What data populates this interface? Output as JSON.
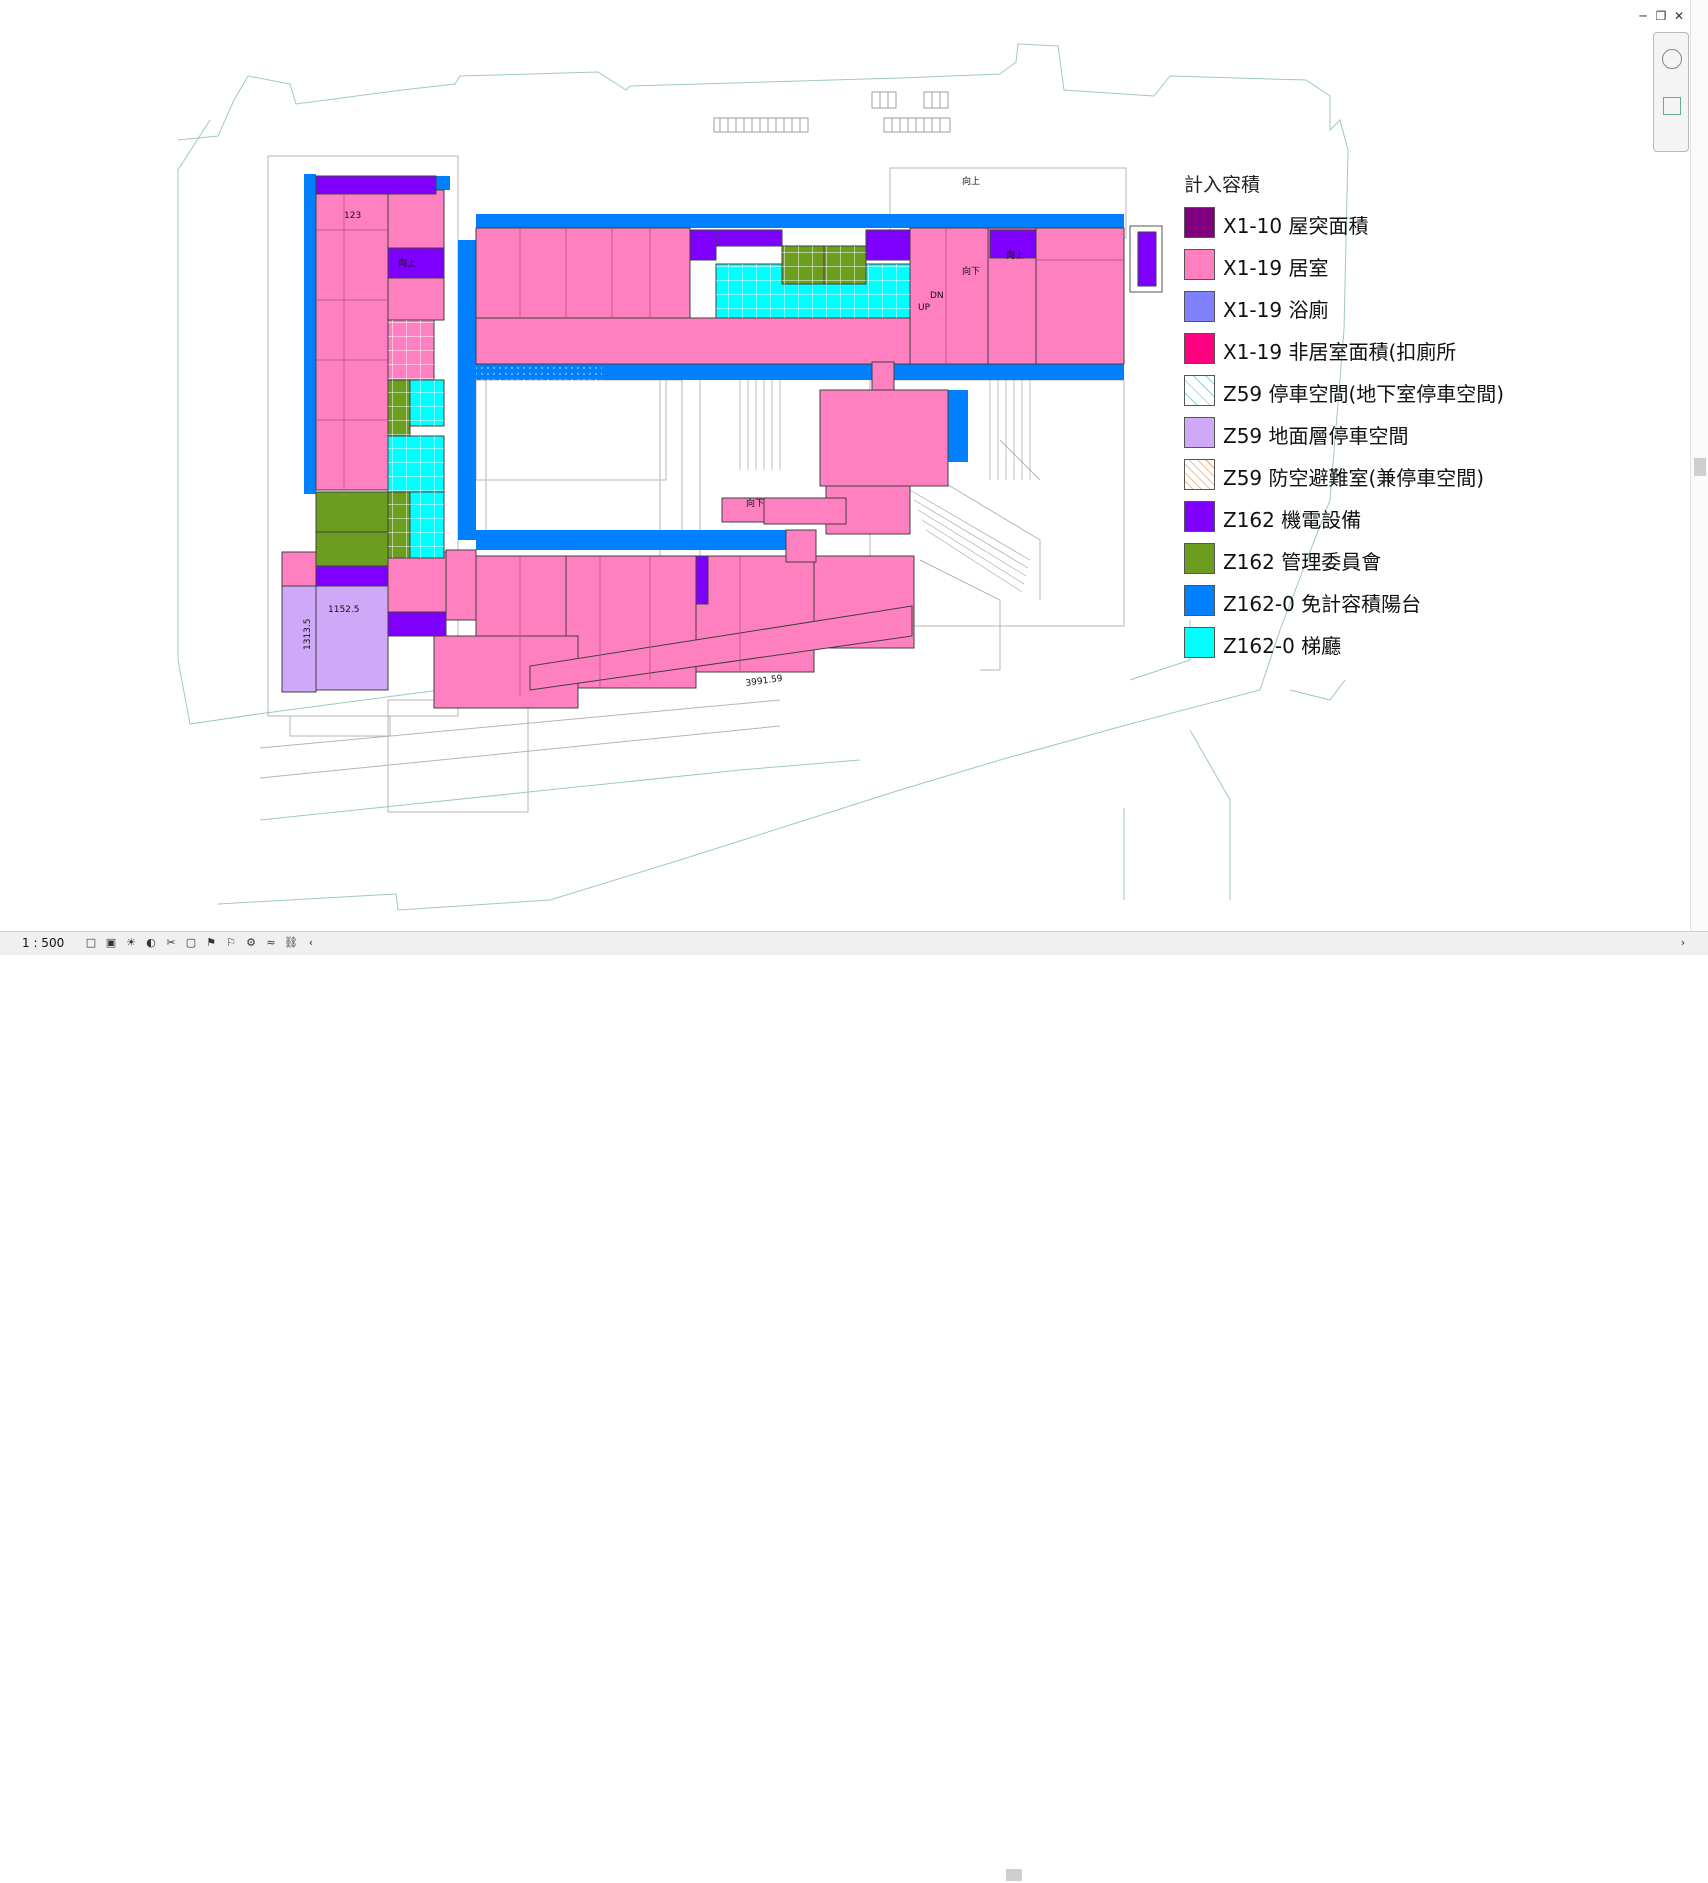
{
  "window_controls": [
    "minimize-icon",
    "restore-icon",
    "close-icon"
  ],
  "legend": {
    "title": "計入容積",
    "items": [
      {
        "label": "X1-10 屋突面積",
        "color": "#7f007f"
      },
      {
        "label": "X1-19 居室",
        "color": "#ff80c0"
      },
      {
        "label": "X1-19 浴廁",
        "color": "#8080ff"
      },
      {
        "label": "X1-19 非居室面積(扣廁所",
        "color": "#ff0080"
      },
      {
        "label": "Z59 停車空間(地下室停車空間)",
        "color": "#ffffff"
      },
      {
        "label": "Z59 地面層停車空間",
        "color": "#d0a8f8"
      },
      {
        "label": "Z59 防空避難室(兼停車空間)",
        "color": "#ffffff"
      },
      {
        "label": "Z162 機電設備",
        "color": "#8000ff"
      },
      {
        "label": "Z162 管理委員會",
        "color": "#6b9e1f"
      },
      {
        "label": "Z162-0 免計容積陽台",
        "color": "#0080ff"
      },
      {
        "label": "Z162-0 梯廳",
        "color": "#00ffff"
      }
    ]
  },
  "plan": {
    "dims": [
      "1152.5",
      "1313.5",
      "3991.59",
      "123"
    ],
    "tags": [
      "向上",
      "向下",
      "向上",
      "向下",
      "向上",
      "UP",
      "DN"
    ]
  },
  "statusbar": {
    "scale": "1 : 500",
    "icons": [
      "detail-level-icon",
      "visual-style-icon",
      "sun-path-icon",
      "shadows-icon",
      "crop-view-icon",
      "show-crop-icon",
      "temporary-hide-icon",
      "reveal-hidden-icon",
      "worksharing-icon",
      "analysis-icon",
      "constraints-icon",
      "scroll-left-icon"
    ]
  }
}
